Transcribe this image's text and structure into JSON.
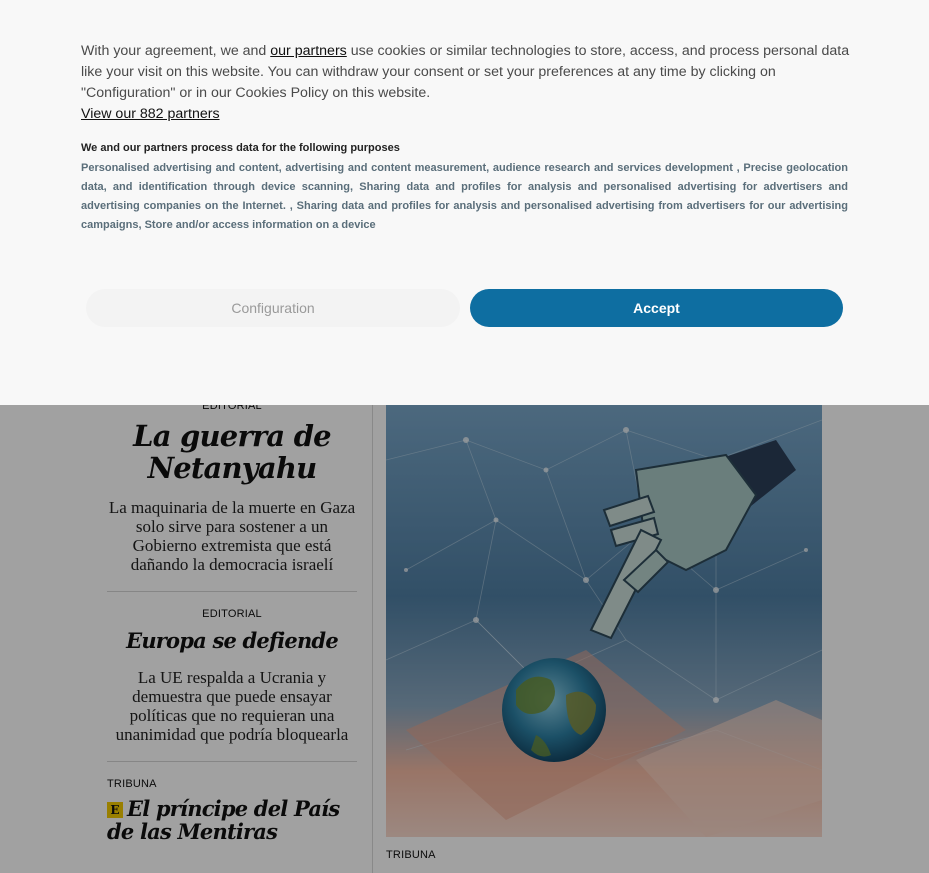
{
  "consent": {
    "intro_before_link": "With your agreement, we and ",
    "partners_link": "our partners",
    "intro_after_link": " use cookies or similar technologies to store, access, and process personal data like your visit on this website. You can withdraw your consent or set your preferences at any time by clicking on \"Configuration\" or in our Cookies Policy on this website.",
    "view_partners": "View our 882 partners",
    "purposes_title": "We and our partners process data for the following purposes",
    "purposes_text": "Personalised advertising and content, advertising and content measurement, audience research and services development , Precise geolocation data, and identification through device scanning, Sharing data and profiles for analysis and personalised advertising for advertisers and advertising companies on the Internet. , Sharing data and profiles for analysis and personalised advertising from advertisers for our advertising campaigns, Store and/or access information on a device",
    "configuration_button": "Configuration",
    "accept_button": "Accept"
  },
  "articles": [
    {
      "kicker": "EDITORIAL",
      "headline": "La guerra de Netanyahu",
      "dek": "La maquinaria de la muerte en Gaza solo sirve para sostener a un Gobierno extremista que está dañando la democracia israelí"
    },
    {
      "kicker": "EDITORIAL",
      "headline": "Europa se defiende",
      "dek": "La UE respalda a Ucrania y demuestra que puede ensayar políticas que no requieran una unanimidad que podría bloquearla"
    },
    {
      "kicker": "TRIBUNA",
      "badge": "E",
      "headline": "El príncipe del País de las Mentiras"
    }
  ],
  "hero": {
    "kicker": "TRIBUNA"
  },
  "colors": {
    "accent": "#0e6ea1",
    "badge": "#f2c900"
  }
}
